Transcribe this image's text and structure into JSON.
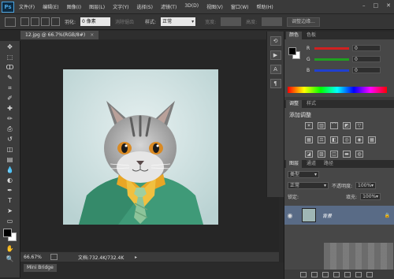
{
  "app": {
    "logo": "Ps"
  },
  "menubar": {
    "items": [
      "文件(F)",
      "编辑(E)",
      "图像(I)",
      "图层(L)",
      "文字(Y)",
      "选择(S)",
      "滤镜(T)",
      "3D(D)",
      "视图(V)",
      "窗口(W)",
      "帮助(H)"
    ],
    "window_buttons": [
      "–",
      "□",
      "✕"
    ]
  },
  "options_bar": {
    "feather_label": "羽化:",
    "feather_value": "0 像素",
    "antialias_label": "消除锯齿",
    "style_label": "样式:",
    "style_value": "正常",
    "width_label": "宽度:",
    "height_label": "高度:",
    "refine_edge_button": "调整边缘..."
  },
  "document": {
    "tab_title": "12.jpg @ 66.7%(RGB/8#)",
    "close": "×",
    "zoom": "66.67%",
    "doc_info": "文档:732.4K/732.4K",
    "arrow": "▸"
  },
  "tools": {
    "icons": [
      "move-icon",
      "marquee-icon",
      "lasso-icon",
      "quick-select-icon",
      "crop-icon",
      "eyedropper-icon",
      "healing-icon",
      "brush-icon",
      "stamp-icon",
      "history-brush-icon",
      "eraser-icon",
      "gradient-icon",
      "blur-icon",
      "dodge-icon",
      "pen-icon",
      "type-icon",
      "path-select-icon",
      "shape-icon",
      "hand-icon",
      "zoom-icon"
    ],
    "glyphs": [
      "✥",
      "⬚",
      "ↀ",
      "✎",
      "⌗",
      "✐",
      "✚",
      "✏",
      "⎙",
      "↺",
      "◫",
      "▤",
      "💧",
      "◐",
      "✒",
      "T",
      "➤",
      "▭",
      "✋",
      "🔍"
    ]
  },
  "color_panel": {
    "tabs": [
      "颜色",
      "色板"
    ],
    "r_label": "R",
    "r_value": "0",
    "g_label": "G",
    "g_value": "0",
    "b_label": "B",
    "b_value": "0",
    "colors": {
      "r_track": "#d02020",
      "g_track": "#20a020",
      "b_track": "#2040d0"
    }
  },
  "adjustments_panel": {
    "tabs": [
      "调整",
      "样式"
    ],
    "title": "添加调整"
  },
  "layers_panel": {
    "tabs": [
      "图层",
      "通道",
      "路径"
    ],
    "kind_label": "类型",
    "blend_mode": "正常",
    "opacity_label": "不透明度:",
    "opacity_value": "100%",
    "lock_label": "锁定:",
    "fill_label": "填充:",
    "fill_value": "100%",
    "layer_name": "背景",
    "lock_icon": "🔒",
    "eye": "◉"
  },
  "bottom_tab": {
    "label": "Mini Bridge"
  },
  "panel_strip": {
    "icons": [
      "history-icon",
      "actions-icon",
      "character-icon",
      "paragraph-icon"
    ],
    "glyphs": [
      "⟲",
      "▶",
      "A",
      "¶"
    ]
  }
}
